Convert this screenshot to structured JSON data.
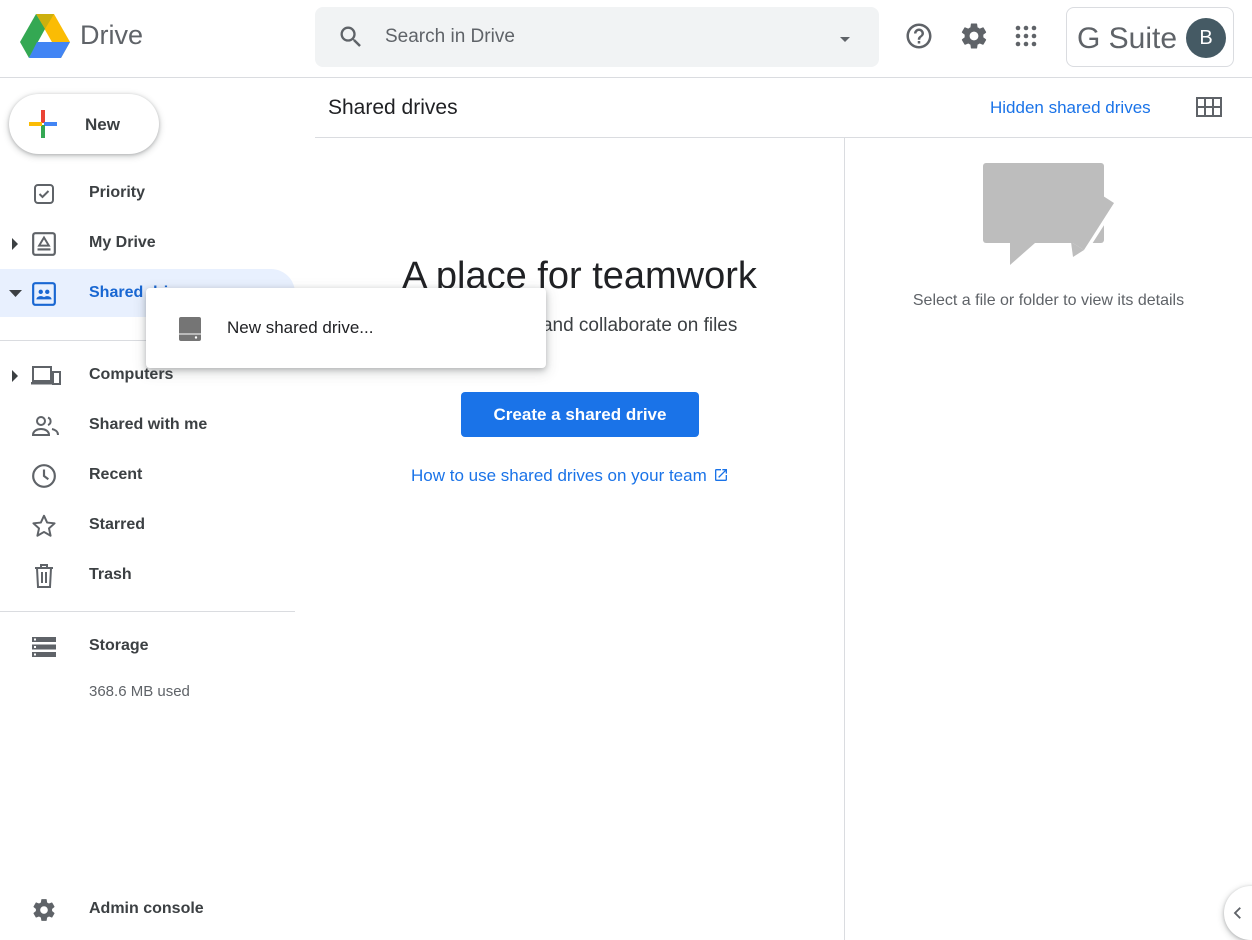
{
  "app": {
    "name": "Drive"
  },
  "search": {
    "placeholder": "Search in Drive"
  },
  "account": {
    "suite_label": "G Suite",
    "avatar_initial": "B"
  },
  "new_button": {
    "label": "New"
  },
  "sidebar": {
    "items": [
      {
        "label": "Priority",
        "icon": "priority-icon"
      },
      {
        "label": "My Drive",
        "icon": "my-drive-icon"
      },
      {
        "label": "Shared drives",
        "icon": "shared-drives-icon"
      },
      {
        "label": "Computers",
        "icon": "computers-icon"
      },
      {
        "label": "Shared with me",
        "icon": "people-icon"
      },
      {
        "label": "Recent",
        "icon": "clock-icon"
      },
      {
        "label": "Starred",
        "icon": "star-icon"
      },
      {
        "label": "Trash",
        "icon": "trash-icon"
      }
    ],
    "storage": {
      "label": "Storage",
      "used": "368.6 MB used"
    },
    "admin_console": "Admin console"
  },
  "header": {
    "title": "Shared drives",
    "hidden_link": "Hidden shared drives"
  },
  "main": {
    "hero_title": "A place for teamwork",
    "hero_desc": "ganize, store, and collaborate on files",
    "create_button": "Create a shared drive",
    "howto_link": "How to use shared drives on your team"
  },
  "details": {
    "placeholder": "Select a file or folder to view its details"
  },
  "context_menu": {
    "item": "New shared drive..."
  },
  "colors": {
    "accent": "#1a73e8",
    "active_bg": "#e8f0fe",
    "active_text": "#1967d2"
  }
}
